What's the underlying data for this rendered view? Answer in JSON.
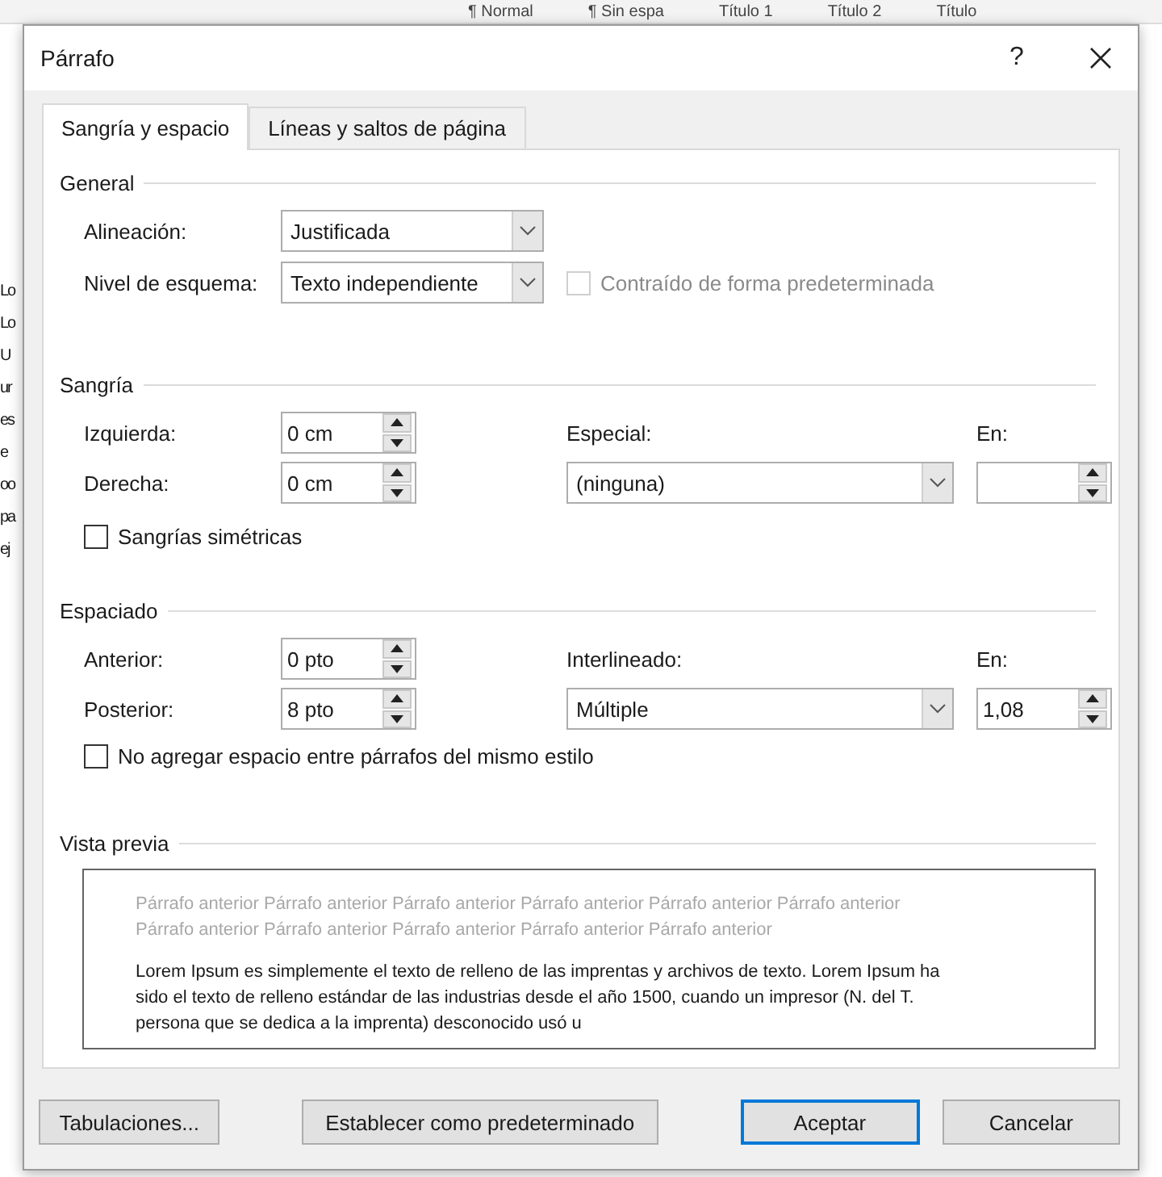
{
  "background": {
    "ribbon_styles": [
      "¶ Normal",
      "¶ Sin espa",
      "Título 1",
      "Título 2",
      "Título"
    ],
    "document_fragments": [
      "Lo",
      "Lo",
      "U",
      "ur",
      "es",
      "e",
      "oo",
      "pa",
      "ej"
    ]
  },
  "window": {
    "title": "Párrafo",
    "help": "?"
  },
  "tabs": [
    {
      "label": "Sangría y espacio",
      "selected": true
    },
    {
      "label": "Líneas y saltos de página",
      "selected": false
    }
  ],
  "general": {
    "title": "General",
    "alignment": {
      "label": "Alineación:",
      "value": "Justificada"
    },
    "outline_level": {
      "label": "Nivel de esquema:",
      "value": "Texto independiente"
    },
    "collapsed": {
      "label": "Contraído de forma predeterminada",
      "checked": false,
      "disabled": true
    }
  },
  "indentation": {
    "title": "Sangría",
    "left": {
      "label": "Izquierda:",
      "value": "0 cm"
    },
    "right": {
      "label": "Derecha:",
      "value": "0 cm"
    },
    "special": {
      "label": "Especial:",
      "value": "(ninguna)"
    },
    "by": {
      "label": "En:"
    },
    "mirror": {
      "label": "Sangrías simétricas",
      "checked": false,
      "disabled": false
    }
  },
  "spacing": {
    "title": "Espaciado",
    "before": {
      "label": "Anterior:",
      "value": "0 pto"
    },
    "after": {
      "label": "Posterior:",
      "value": "8 pto"
    },
    "line_spacing": {
      "label": "Interlineado:",
      "value": "Múltiple"
    },
    "at": {
      "label": "En:",
      "value": "1,08"
    },
    "no_space": {
      "label": "No agregar espacio entre párrafos del mismo estilo",
      "checked": false,
      "disabled": false
    }
  },
  "preview": {
    "title": "Vista previa",
    "previous_lines": [
      "Párrafo anterior Párrafo anterior Párrafo anterior Párrafo anterior Párrafo anterior Párrafo anterior",
      "Párrafo anterior Párrafo anterior Párrafo anterior Párrafo anterior Párrafo anterior"
    ],
    "lines": [
      "Lorem Ipsum es simplemente el texto de relleno de las imprentas y archivos de texto. Lorem Ipsum ha",
      "sido el texto de relleno estándar de las industrias desde el año 1500, cuando un impresor (N. del T.",
      "persona que se dedica a la imprenta) desconocido usó u"
    ]
  },
  "buttons": [
    {
      "label": "Tabulaciones...",
      "default": false
    },
    {
      "label": "Establecer como predeterminado",
      "default": false
    },
    {
      "label": "Aceptar",
      "default": true
    },
    {
      "label": "Cancelar",
      "default": false
    }
  ]
}
